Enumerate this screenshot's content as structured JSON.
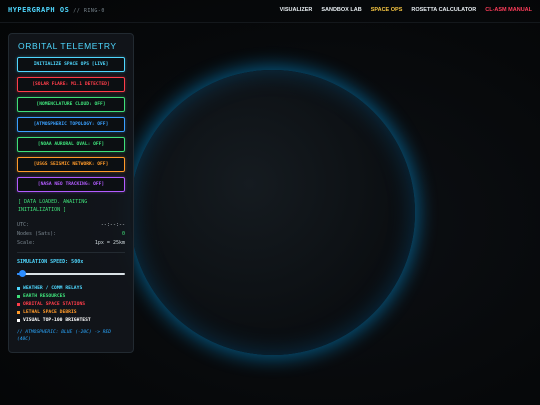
{
  "app": {
    "brand": "HYPERGRAPH OS",
    "subtitle": "// RING-0"
  },
  "nav": [
    {
      "label": "VISUALIZER",
      "color": "#e8eef2"
    },
    {
      "label": "SANDBOX LAB",
      "color": "#e8eef2"
    },
    {
      "label": "SPACE OPS",
      "color": "#f5c542"
    },
    {
      "label": "ROSETTA CALCULATOR",
      "color": "#e8eef2"
    },
    {
      "label": "CL-ASM MANUAL",
      "color": "#ff3d5a"
    }
  ],
  "panel": {
    "title": "ORBITAL TELEMETRY",
    "buttons": [
      {
        "label": "INITIALIZE SPACE OPS [LIVE]",
        "color": "#4fd8ff"
      },
      {
        "label": "[SOLAR FLARE: M1.1 DETECTED]",
        "color": "#ff3d4a"
      },
      {
        "label": "[NOMENCLATURE CLOUD: OFF]",
        "color": "#3fe07a"
      },
      {
        "label": "[ATMOSPHERIC TOPOLOGY: OFF]",
        "color": "#3aa0ff"
      },
      {
        "label": "[NOAA AURORAL OVAL: OFF]",
        "color": "#3fe07a"
      },
      {
        "label": "[USGS SEISMIC NETWORK: OFF]",
        "color": "#ff9a2a"
      },
      {
        "label": "[NASA NEO TRACKING: OFF]",
        "color": "#b35cff"
      }
    ],
    "status": "[ DATA LOADED. AWAITING INITIALIZATION ]",
    "utc_label": "UTC:",
    "utc_value": "--:--:--",
    "nodes_label": "Nodes (Sats):",
    "nodes_value": "0",
    "scale_label": "Scale:",
    "scale_value": "1px = 25km",
    "speed_label": "SIMULATION SPEED: 500x",
    "speed_fraction": 0.05,
    "legend": [
      {
        "label": "WEATHER / COMM RELAYS",
        "color": "#4fd8ff"
      },
      {
        "label": "EARTH RESOURCES",
        "color": "#3fe07a"
      },
      {
        "label": "ORBITAL SPACE STATIONS",
        "color": "#ff3d4a"
      },
      {
        "label": "LETHAL SPACE DEBRIS",
        "color": "#ff9a2a"
      },
      {
        "label": "VISUAL TOP-100 BRIGHTEST",
        "color": "#ffffff"
      }
    ],
    "note": "// ATMOSPHERIC: BLUE (-20C) -> RED (40C)"
  }
}
